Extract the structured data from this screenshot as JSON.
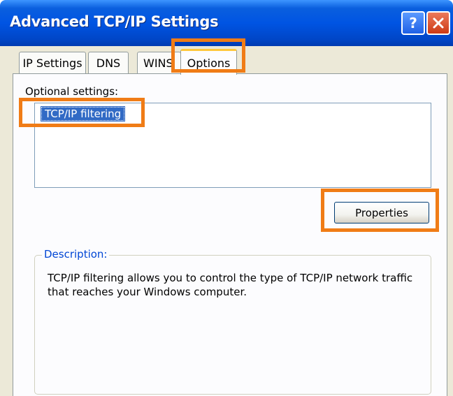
{
  "window": {
    "title": "Advanced TCP/IP Settings",
    "help_button": "help-icon",
    "close_button": "close-icon"
  },
  "tabs": [
    {
      "label": "IP Settings",
      "selected": false
    },
    {
      "label": "DNS",
      "selected": false
    },
    {
      "label": "WINS",
      "selected": false
    },
    {
      "label": "Options",
      "selected": true
    }
  ],
  "options_panel": {
    "list_label": "Optional settings:",
    "list_items": [
      {
        "label": "TCP/IP filtering",
        "selected": true
      }
    ],
    "properties_button": "Properties",
    "description_title": "Description:",
    "description_text": "TCP/IP filtering allows you to control the type of TCP/IP network traffic that reaches your Windows computer."
  },
  "colors": {
    "title_bar": "#0054e3",
    "highlight_outline": "#f07c16",
    "selection": "#316ac5",
    "group_title": "#0046d5"
  }
}
